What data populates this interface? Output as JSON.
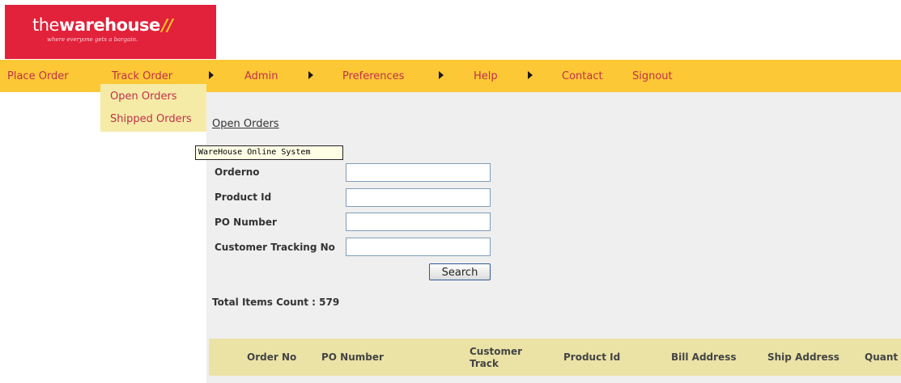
{
  "logo": {
    "brand_light": "the",
    "brand_bold": "warehouse",
    "slashes": "//",
    "tagline": "where everyone gets a bargain."
  },
  "menu": {
    "place_order": "Place Order",
    "track_order": "Track Order",
    "admin": "Admin",
    "preferences": "Preferences",
    "help": "Help",
    "contact": "Contact",
    "signout": "Signout"
  },
  "dropdown": {
    "open_orders": "Open Orders",
    "shipped_orders": "Shipped Orders"
  },
  "page": {
    "title": "Open Orders",
    "tooltip": "WareHouse Online System"
  },
  "form": {
    "orderno_label": "Orderno",
    "orderno_value": "",
    "product_id_label": "Product Id",
    "product_id_value": "",
    "po_number_label": "PO Number",
    "po_number_value": "",
    "customer_tracking_label": "Customer Tracking No",
    "customer_tracking_value": "",
    "search_label": "Search"
  },
  "summary": {
    "total_items": "Total Items Count : 579"
  },
  "table": {
    "columns": [
      "Order No",
      "PO Number",
      "Customer\nTrack",
      "Product Id",
      "Bill Address",
      "Ship Address",
      "Quant"
    ]
  },
  "colors": {
    "logo_red": "#e2213a",
    "menu_yellow": "#fdc836",
    "menu_text": "#c0304a",
    "dropdown_bg": "#f5eba6",
    "content_bg": "#efefef",
    "table_header_bg": "#ebe3a6"
  }
}
